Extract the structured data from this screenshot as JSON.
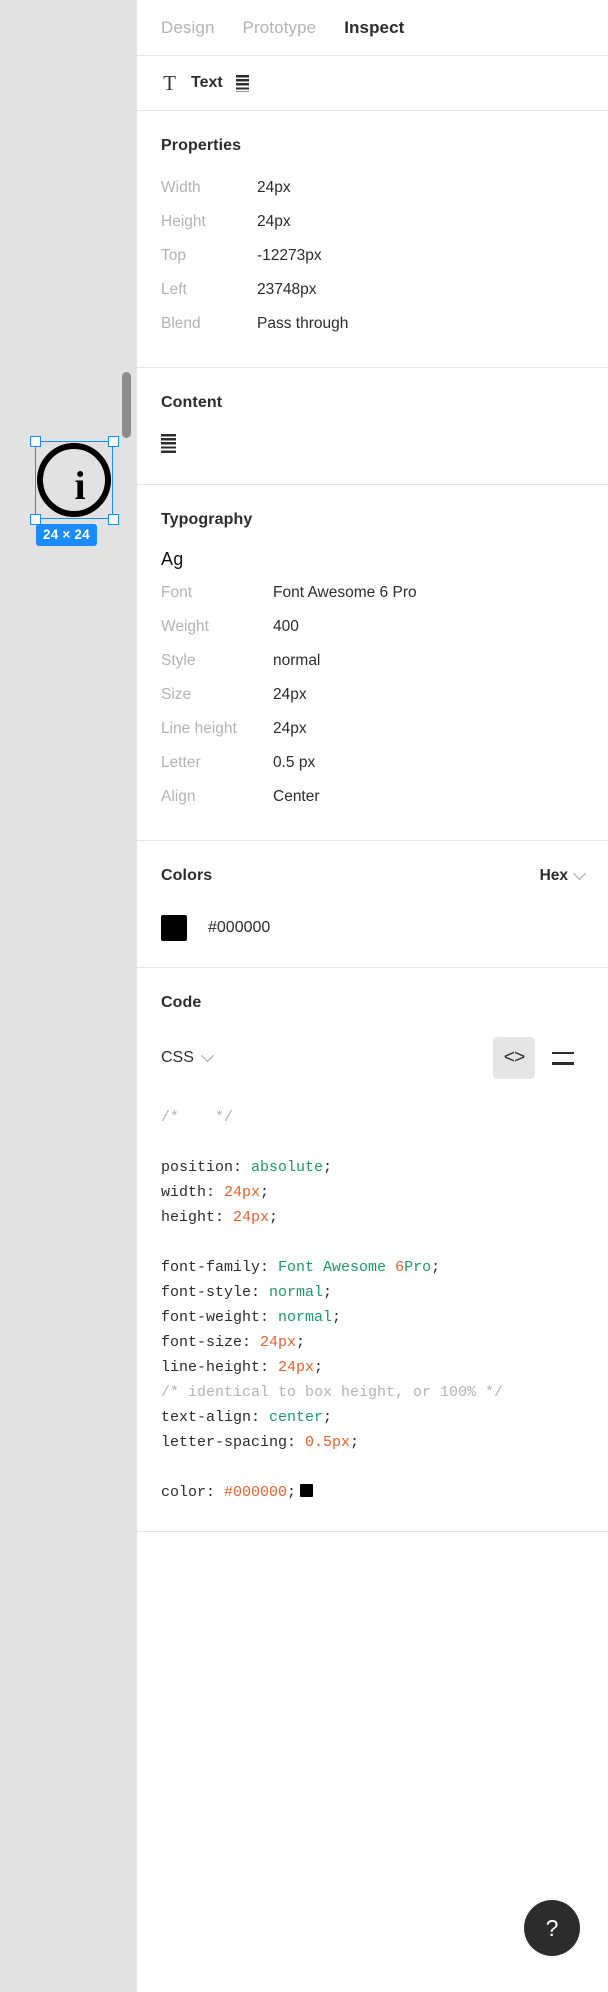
{
  "canvas": {
    "selection_badge": "24 × 24",
    "icon_glyph": "i",
    "icon_name": "info-circle-icon"
  },
  "tabs": [
    {
      "label": "Design",
      "active": false
    },
    {
      "label": "Prototype",
      "active": false
    },
    {
      "label": "Inspect",
      "active": true
    }
  ],
  "layer": {
    "type_icon": "T",
    "name": "Text"
  },
  "properties": {
    "title": "Properties",
    "rows": [
      {
        "key": "Width",
        "value": "24px"
      },
      {
        "key": "Height",
        "value": "24px"
      },
      {
        "key": "Top",
        "value": "-12273px"
      },
      {
        "key": "Left",
        "value": "23748px"
      },
      {
        "key": "Blend",
        "value": "Pass through"
      }
    ]
  },
  "content": {
    "title": "Content",
    "glyph_name": "stacked-bars-glyph"
  },
  "typography": {
    "title": "Typography",
    "sample": "Ag",
    "rows": [
      {
        "key": "Font",
        "value": "Font Awesome 6 Pro"
      },
      {
        "key": "Weight",
        "value": "400"
      },
      {
        "key": "Style",
        "value": "normal"
      },
      {
        "key": "Size",
        "value": "24px"
      },
      {
        "key": "Line height",
        "value": "24px"
      },
      {
        "key": "Letter",
        "value": "0.5 px"
      },
      {
        "key": "Align",
        "value": "Center"
      }
    ]
  },
  "colors": {
    "title": "Colors",
    "format": "Hex",
    "swatches": [
      {
        "hex": "#000000",
        "label": "#000000"
      }
    ]
  },
  "code": {
    "title": "Code",
    "language": "CSS",
    "view_code_label": "<>",
    "lines": [
      {
        "type": "comment",
        "text": "/*    */"
      },
      {
        "type": "blank"
      },
      {
        "type": "decl",
        "prop": "position: ",
        "value": "absolute",
        "value_kind": "kw",
        "end": ";"
      },
      {
        "type": "decl",
        "prop": "width: ",
        "value": "24px",
        "value_kind": "num",
        "end": ";"
      },
      {
        "type": "decl",
        "prop": "height: ",
        "value": "24px",
        "value_kind": "num",
        "end": ";"
      },
      {
        "type": "blank"
      },
      {
        "type": "fontfamily",
        "prop": "font-family: ",
        "kw1": "Font Awesome ",
        "num": "6",
        "kw2": "Pro",
        "end": ";"
      },
      {
        "type": "decl",
        "prop": "font-style: ",
        "value": "normal",
        "value_kind": "kw",
        "end": ";"
      },
      {
        "type": "decl",
        "prop": "font-weight: ",
        "value": "normal",
        "value_kind": "kw",
        "end": ";"
      },
      {
        "type": "decl",
        "prop": "font-size: ",
        "value": "24px",
        "value_kind": "num",
        "end": ";"
      },
      {
        "type": "decl",
        "prop": "line-height: ",
        "value": "24px",
        "value_kind": "num",
        "end": ";"
      },
      {
        "type": "comment",
        "text": "/* identical to box height, or 100% */"
      },
      {
        "type": "decl",
        "prop": "text-align: ",
        "value": "center",
        "value_kind": "kw",
        "end": ";"
      },
      {
        "type": "decl",
        "prop": "letter-spacing: ",
        "value": "0.5px",
        "value_kind": "num",
        "end": ";"
      },
      {
        "type": "blank"
      },
      {
        "type": "color",
        "prop": "color: ",
        "value": "#000000",
        "end": ";",
        "swatch": "#000000"
      }
    ]
  },
  "help": {
    "label": "?"
  },
  "theme": {
    "accent_blue": "#1a8cff",
    "canvas_bg": "#e2e2e2",
    "text_dark": "#2c2c2c",
    "text_muted": "#b3b3b3",
    "code_keyword": "#1a9a6a",
    "code_number": "#e8602c"
  }
}
